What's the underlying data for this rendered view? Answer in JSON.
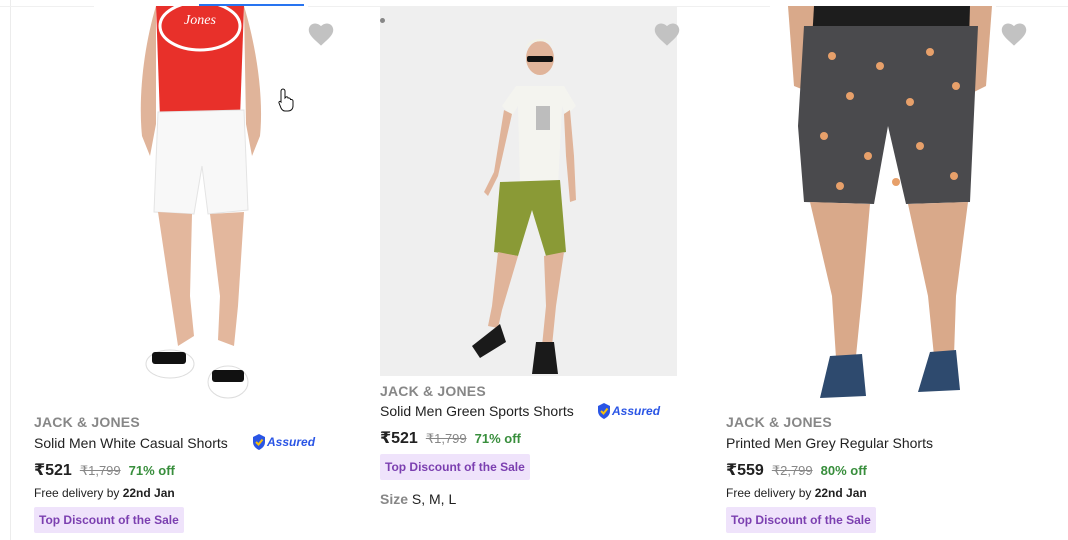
{
  "products": [
    {
      "brand": "JACK & JONES",
      "title": "Solid Men White Casual Shorts",
      "price": "₹521",
      "mrp": "₹1,799",
      "discount": "71% off",
      "delivery_prefix": "Free delivery by ",
      "delivery_date": "22nd Jan",
      "badge": "Top Discount of the Sale",
      "assured": "Assured",
      "wishlist_icon": "heart-icon"
    },
    {
      "brand": "JACK & JONES",
      "title": "Solid Men Green Sports Shorts",
      "price": "₹521",
      "mrp": "₹1,799",
      "discount": "71% off",
      "badge": "Top Discount of the Sale",
      "sizes_label": "Size",
      "sizes": "S, M, L",
      "assured": "Assured",
      "wishlist_icon": "heart-icon"
    },
    {
      "brand": "JACK & JONES",
      "title": "Printed Men Grey Regular Shorts",
      "price": "₹559",
      "mrp": "₹2,799",
      "discount": "80% off",
      "delivery_prefix": "Free delivery by ",
      "delivery_date": "22nd Jan",
      "badge": "Top Discount of the Sale",
      "wishlist_icon": "heart-icon"
    }
  ],
  "colors": {
    "accent": "#2874f0",
    "discount_green": "#388e3c",
    "badge_bg": "#efe3fb",
    "badge_text": "#7b3fb0",
    "assured_blue": "#2a55e5",
    "heart_grey": "#c2c2c2"
  }
}
